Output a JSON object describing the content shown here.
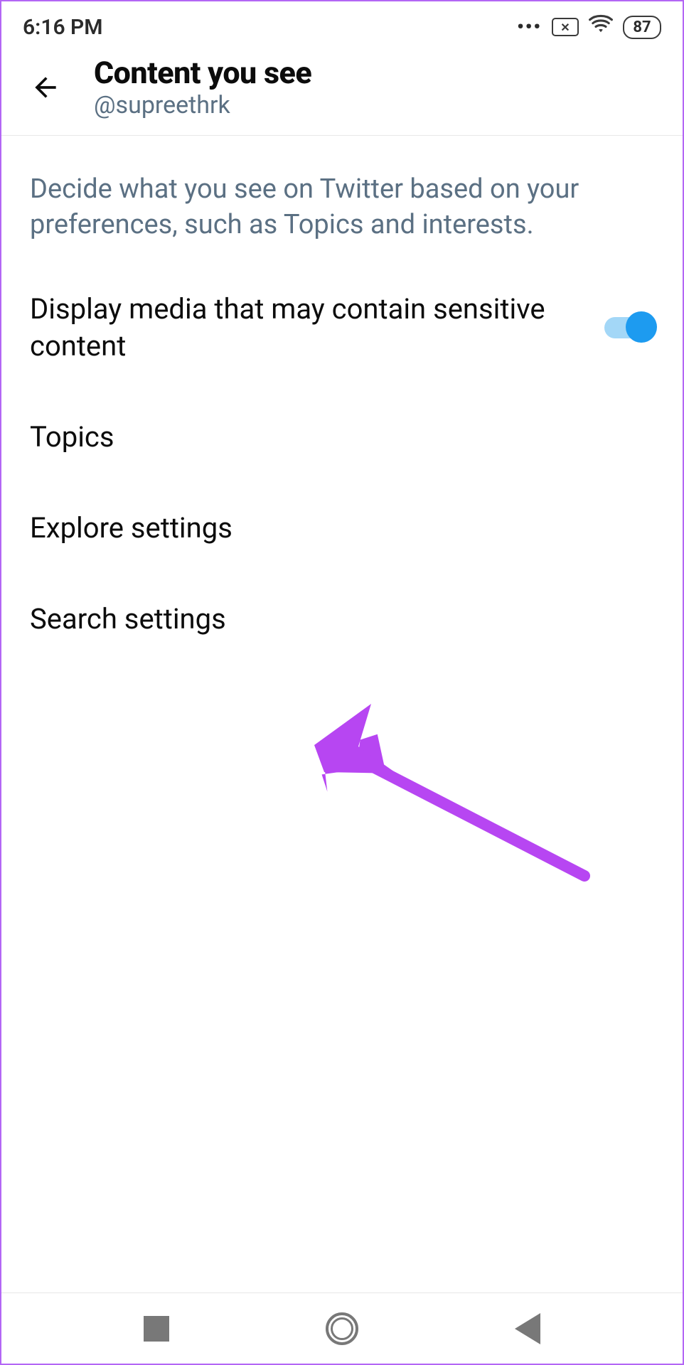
{
  "status": {
    "time": "6:16 PM",
    "battery": "87"
  },
  "header": {
    "title": "Content you see",
    "subtitle": "@supreethrk"
  },
  "description": "Decide what you see on Twitter based on your preferences, such as Topics and interests.",
  "items": [
    {
      "label": "Display media that may contain sensitive content",
      "toggle": true
    },
    {
      "label": "Topics"
    },
    {
      "label": "Explore settings"
    },
    {
      "label": "Search settings"
    }
  ],
  "colors": {
    "accent": "#1d9bf0",
    "annotation": "#b746f2"
  }
}
